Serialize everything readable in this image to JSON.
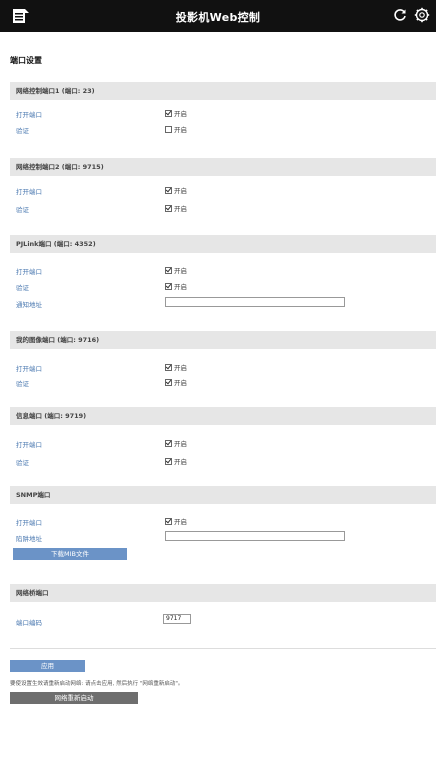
{
  "header": {
    "title": "投影机Web控制",
    "menu_icon": "document-menu-icon",
    "refresh_icon": "refresh-icon",
    "settings_icon": "gear-icon"
  },
  "page_title": "端口设置",
  "sections": [
    {
      "title": "网络控制端口1 (端口: 23)",
      "rows": [
        {
          "label": "打开端口",
          "type": "checkbox",
          "checked": true,
          "text": "开启"
        },
        {
          "label": "验证",
          "type": "checkbox",
          "checked": false,
          "text": "开启"
        }
      ]
    },
    {
      "title": "网络控制端口2 (端口: 9715)",
      "rows": [
        {
          "label": "打开端口",
          "type": "checkbox",
          "checked": true,
          "text": "开启"
        },
        {
          "label": "验证",
          "type": "checkbox",
          "checked": true,
          "text": "开启"
        }
      ]
    },
    {
      "title": "PJLink端口 (端口: 4352)",
      "rows": [
        {
          "label": "打开端口",
          "type": "checkbox",
          "checked": true,
          "text": "开启"
        },
        {
          "label": "验证",
          "type": "checkbox",
          "checked": true,
          "text": "开启"
        },
        {
          "label": "通知地址",
          "type": "text",
          "value": ""
        }
      ]
    },
    {
      "title": "我的图像端口 (端口: 9716)",
      "rows": [
        {
          "label": "打开端口",
          "type": "checkbox",
          "checked": true,
          "text": "开启"
        },
        {
          "label": "验证",
          "type": "checkbox",
          "checked": true,
          "text": "开启"
        }
      ]
    },
    {
      "title": "信息端口 (端口: 9719)",
      "rows": [
        {
          "label": "打开端口",
          "type": "checkbox",
          "checked": true,
          "text": "开启"
        },
        {
          "label": "验证",
          "type": "checkbox",
          "checked": true,
          "text": "开启"
        }
      ]
    },
    {
      "title": "SNMP端口",
      "rows": [
        {
          "label": "打开端口",
          "type": "checkbox",
          "checked": true,
          "text": "开启"
        },
        {
          "label": "陷阱地址",
          "type": "text",
          "value": ""
        }
      ],
      "button": "下载MIB文件"
    },
    {
      "title": "网络桥端口",
      "rows": [
        {
          "label": "端口编码",
          "type": "port",
          "value": "9717"
        }
      ]
    }
  ],
  "apply_button": "应用",
  "note": "要使设置生效请重新启动网络: 请点击应用, 然后执行 \"网络重新启动\"。",
  "restart_button": "网络重新启动",
  "colors": {
    "topbar": "#111111",
    "section_header": "#e6e6e6",
    "label_blue": "#4a78b0",
    "button_blue": "#6b93c7",
    "button_gray": "#6e6e6e"
  }
}
